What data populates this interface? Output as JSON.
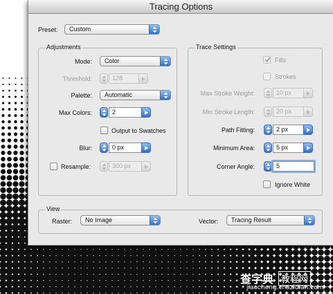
{
  "dialog": {
    "title": "Tracing Options",
    "preset": {
      "label": "Preset:",
      "value": "Custom"
    },
    "adjustments": {
      "title": "Adjustments",
      "mode": {
        "label": "Mode:",
        "value": "Color"
      },
      "threshold": {
        "label": "Threshold:",
        "value": "128"
      },
      "palette": {
        "label": "Palette:",
        "value": "Automatic"
      },
      "max_colors": {
        "label": "Max Colors:",
        "value": "2"
      },
      "output_to_swatches": {
        "label": "Output to Swatches",
        "checked": false
      },
      "blur": {
        "label": "Blur:",
        "value": "0 px"
      },
      "resample": {
        "label": "Resample:",
        "value": "300 px",
        "checked": false
      }
    },
    "trace_settings": {
      "title": "Trace Settings",
      "fills": {
        "label": "Fills",
        "checked": true
      },
      "strokes": {
        "label": "Strokes",
        "checked": false
      },
      "max_stroke_weight": {
        "label": "Max Stroke Weight:",
        "value": "10 px"
      },
      "min_stroke_length": {
        "label": "Min Stroke Length:",
        "value": "20 px"
      },
      "path_fitting": {
        "label": "Path Fitting:",
        "value": "2 px"
      },
      "minimum_area": {
        "label": "Minimum Area:",
        "value": "5 px"
      },
      "corner_angle": {
        "label": "Corner Angle:",
        "value": "5"
      },
      "ignore_white": {
        "label": "Ignore White",
        "checked": false
      }
    },
    "view": {
      "title": "View",
      "raster": {
        "label": "Raster:",
        "value": "No Image"
      },
      "vector": {
        "label": "Vector:",
        "value": "Tracing Result"
      }
    }
  },
  "watermark": {
    "brand": "查字典",
    "section": "教程网",
    "url": "jiaocheng.chazidian.com"
  },
  "colors": {
    "accent": "#3d7fe0",
    "dialog_bg": "#e9e9e9",
    "halftone": "#111111"
  }
}
